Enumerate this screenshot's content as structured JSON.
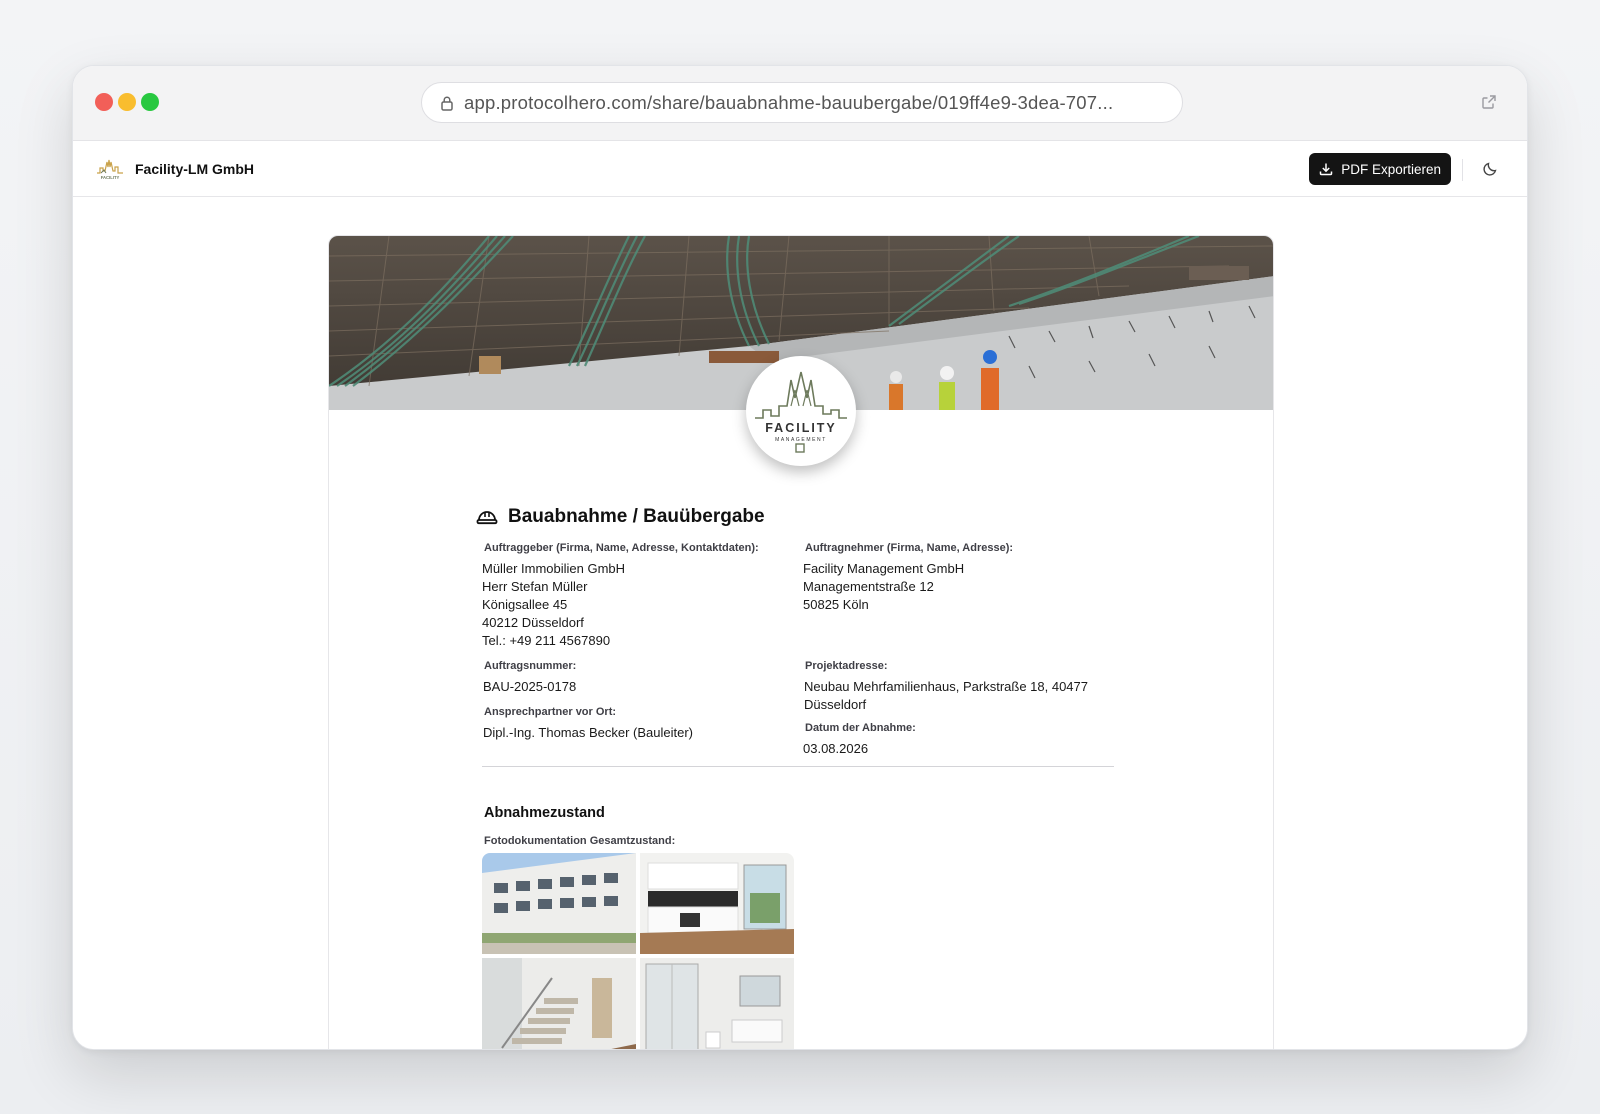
{
  "browser": {
    "url": "app.protocolhero.com/share/bauabnahme-bauubergabe/019ff4e9-3dea-707..."
  },
  "appbar": {
    "company_name": "Facility-LM GmbH",
    "pdf_button_label": "PDF Exportieren",
    "logo_text": "FACILITY"
  },
  "document": {
    "logo": {
      "main": "FACILITY",
      "sub": "MANAGEMENT"
    },
    "title": "Bauabnahme / Bauübergabe",
    "client": {
      "label": "Auftraggeber (Firma, Name, Adresse, Kontaktdaten):",
      "lines": [
        "Müller Immobilien GmbH",
        "Herr Stefan Müller",
        "Königsallee 45",
        "40212 Düsseldorf",
        "Tel.: +49 211 4567890"
      ]
    },
    "contractor": {
      "label": "Auftragnehmer (Firma, Name, Adresse):",
      "lines": [
        "Facility Management GmbH",
        "Managementstraße 12",
        "50825 Köln"
      ]
    },
    "order_number": {
      "label": "Auftragsnummer:",
      "value": "BAU-2025-0178"
    },
    "project_address": {
      "label": "Projektadresse:",
      "value": "Neubau Mehrfamilienhaus, Parkstraße 18, 40477 Düsseldorf"
    },
    "contact_person": {
      "label": "Ansprechpartner vor Ort:",
      "value": "Dipl.-Ing. Thomas Becker (Bauleiter)"
    },
    "acceptance_date": {
      "label": "Datum der Abnahme:",
      "value": "03.08.2026"
    },
    "section": {
      "heading": "Abnahmezustand",
      "photo_label": "Fotodokumentation Gesamtzustand:"
    }
  },
  "colors": {
    "button_bg": "#141414",
    "logo_green": "#6d7a5c",
    "logo_gold": "#c9a24a"
  }
}
